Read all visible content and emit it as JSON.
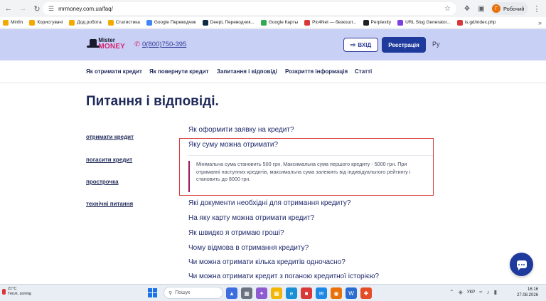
{
  "browser": {
    "url": "mrmoney.com.ua/faq/",
    "profile_label": "Робочий",
    "profile_initial": "Г",
    "bookmarks": [
      {
        "label": "Minfin",
        "color": "#f2a900"
      },
      {
        "label": "Користувачі",
        "color": "#f2a900"
      },
      {
        "label": "Дод.робота",
        "color": "#f2a900"
      },
      {
        "label": "Статистика",
        "color": "#f2a900"
      },
      {
        "label": "Google Переводчик",
        "color": "#4285f4"
      },
      {
        "label": "DeepL Переводчик...",
        "color": "#0f2b46"
      },
      {
        "label": "Google Карты",
        "color": "#34a853"
      },
      {
        "label": "Pic4Net — безкошт...",
        "color": "#d93838"
      },
      {
        "label": "Perplexity",
        "color": "#202124"
      },
      {
        "label": "URL Slug Generator...",
        "color": "#7b3fe4"
      },
      {
        "label": "is.gd/index.php",
        "color": "#d93838"
      }
    ]
  },
  "header": {
    "logo_top": "Mister",
    "logo_bottom": "MONEY",
    "phone": "0(800)750-395",
    "login_label": "ВХІД",
    "register_label": "Реєстрація",
    "lang_label": "Ру",
    "accent_color": "#d6246e",
    "brand_color": "#1e3a9c"
  },
  "nav": {
    "items": [
      "Як отримати кредит",
      "Як повернути кредит",
      "Запитання і відповіді",
      "Розкриття інформація",
      "Статті"
    ]
  },
  "page": {
    "title": "Питання і відповіді.",
    "categories": [
      "отримати кредит",
      "погасити кредит",
      "прострочка",
      "технічні питання"
    ],
    "faq": [
      {
        "question": "Як оформити заявку на кредит?"
      },
      {
        "question": "Яку суму можна отримати?",
        "answer": "Мінімальна сума становить 500 грн. Максимальна сума першого кредиту - 5000 грн. При отриманні наступних кредитів, максимальна сума залежить від індивідуального рейтингу і становить до 8000 грн."
      },
      {
        "question": "Які документи необхідні для отримання кредиту?"
      },
      {
        "question": "На яку карту можна отримати кредит?"
      },
      {
        "question": "Як швидко я отримаю гроші?"
      },
      {
        "question": "Чому відмова в отримання кредиту?"
      },
      {
        "question": "Чи можна отримати кілька кредитів одночасно?"
      },
      {
        "question": "Чи можна отримати кредит з поганою кредитної історією?"
      }
    ]
  },
  "taskbar": {
    "temperature": "21°C",
    "weather_text": "Теплі, sonnig",
    "search_placeholder": "Пошук",
    "language": "УКР",
    "time": "16:16",
    "date": "27.08.2026"
  }
}
